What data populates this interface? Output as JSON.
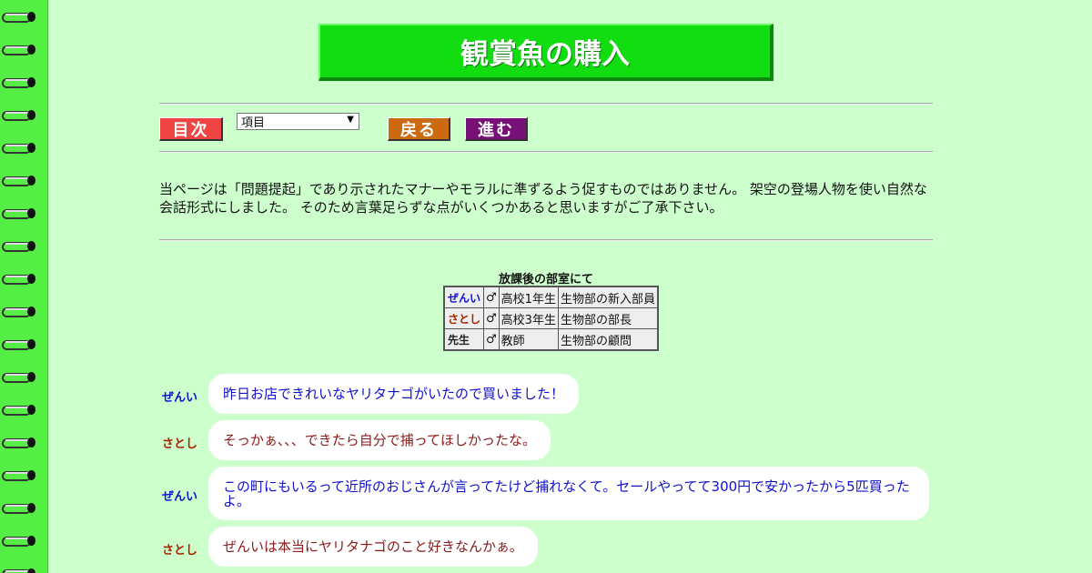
{
  "title": "観賞魚の購入",
  "nav": {
    "toc_label": "目次",
    "select_value": "項目",
    "back_label": "戻る",
    "next_label": "進む"
  },
  "notice": "当ページは「問題提起」であり示されたマナーやモラルに準ずるよう促すものではありません。 架空の登場人物を使い自然な会話形式にしました。 そのため言葉足らずな点がいくつかあると思いますがご了承下さい。",
  "cast": {
    "caption": "放課後の部室にて",
    "rows": [
      {
        "name": "ぜんい",
        "sex": "♂",
        "grade": "高校1年生",
        "role": "生物部の新入部員"
      },
      {
        "name": "さとし",
        "sex": "♂",
        "grade": "高校3年生",
        "role": "生物部の部長"
      },
      {
        "name": "先生",
        "sex": "♂",
        "grade": "教師",
        "role": "生物部の顧問"
      }
    ]
  },
  "dialogue": [
    {
      "speaker": "ぜんい",
      "text": "昨日お店できれいなヤリタナゴがいたので買いました！"
    },
    {
      "speaker": "さとし",
      "text": "そっかぁ、、、できたら自分で捕ってほしかったな。"
    },
    {
      "speaker": "ぜんい",
      "text": "この町にもいるって近所のおじさんが言ってたけど捕れなくて。セールやってて300円で安かったから5匹買ったよ。"
    },
    {
      "speaker": "さとし",
      "text": "ぜんいは本当にヤリタナゴのこと好きなんかぁ。"
    }
  ],
  "colors": {
    "background": "#ccffcc",
    "binding": "#55ee44",
    "title_box": "#11dd11",
    "toc_button": "#ee4444",
    "back_button": "#cc6a11",
    "next_button": "#771177",
    "zenni_text": "#1111cc",
    "satoshi_text": "#8b1a1a"
  }
}
